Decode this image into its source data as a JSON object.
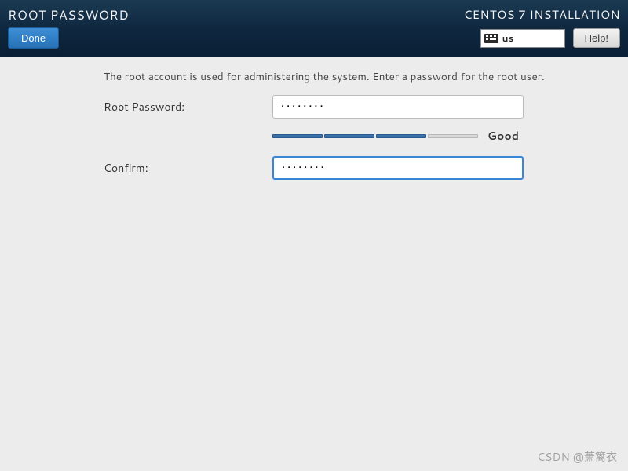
{
  "header": {
    "title": "ROOT PASSWORD",
    "installer": "CENTOS 7 INSTALLATION",
    "done_label": "Done",
    "help_label": "Help!",
    "keyboard_layout": "us"
  },
  "form": {
    "instruction": "The root account is used for administering the system.  Enter a password for the root user.",
    "root_password_label": "Root Password:",
    "confirm_label": "Confirm:",
    "root_password_value": "••••••••",
    "confirm_value": "••••••••",
    "strength": {
      "segments_filled": 3,
      "segments_total": 4,
      "label": "Good"
    }
  },
  "watermark": "CSDN @萧篱衣"
}
